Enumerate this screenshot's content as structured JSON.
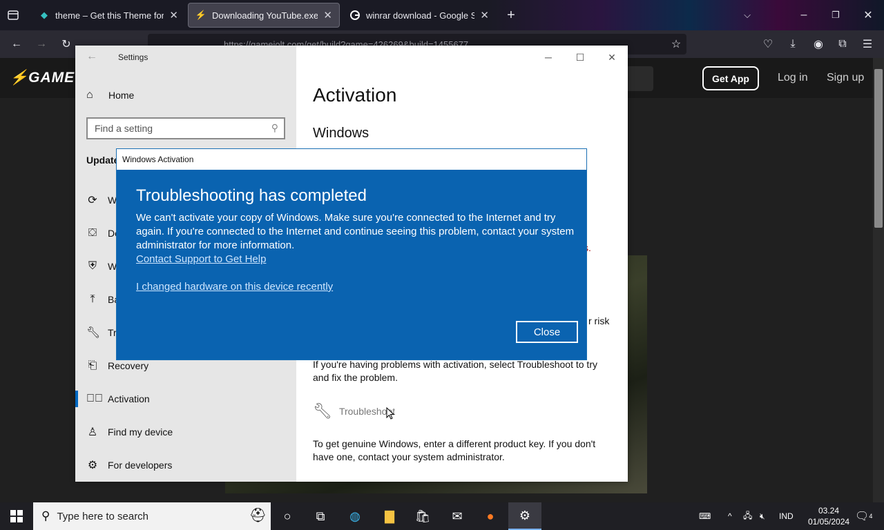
{
  "browser": {
    "tabs": [
      {
        "title": "theme – Get this Theme for",
        "favicon": "fox-icon"
      },
      {
        "title": "Downloading YouTube.exe (Ga",
        "favicon": "gamejolt-icon"
      },
      {
        "title": "winrar download - Google Sear",
        "favicon": "google-icon"
      }
    ],
    "url": "https://gamejolt.com/get/build?game=426269&build=1455677"
  },
  "site": {
    "logo": "GAME",
    "get_app": "Get App",
    "login": "Log in",
    "signup": "Sign up"
  },
  "settings": {
    "window_title": "Settings",
    "home": "Home",
    "search_placeholder": "Find a setting",
    "section": "Update",
    "nav": [
      {
        "label": "W",
        "icon": "sync-icon"
      },
      {
        "label": "De",
        "icon": "delivery-optimization-icon"
      },
      {
        "label": "W",
        "icon": "shield-icon"
      },
      {
        "label": "Ba",
        "icon": "backup-icon"
      },
      {
        "label": "Tr",
        "icon": "wrench-icon"
      },
      {
        "label": "Recovery",
        "icon": "recovery-icon"
      },
      {
        "label": "Activation",
        "icon": "check-circle-icon"
      },
      {
        "label": "Find my device",
        "icon": "person-pin-icon"
      },
      {
        "label": "For developers",
        "icon": "developer-icon"
      }
    ],
    "page_title": "Activation",
    "subheading": "Windows",
    "fragment_s": "s.",
    "fragment_risk": "r risk",
    "trouble_text": "If you're having problems with activation, select Troubleshoot to try and fix the problem.",
    "troubleshoot": "Troubleshoot",
    "product_key_text": "To get genuine Windows, enter a different product key. If you don't have one, contact your system administrator."
  },
  "dialog": {
    "title": "Windows Activation",
    "heading": "Troubleshooting has completed",
    "message": "We can't activate your copy of Windows. Make sure you're connected to the Internet and try again. If you're connected to the Internet and continue seeing this problem, contact your system administrator for more information.",
    "link_support": "Contact Support to Get Help",
    "link_hardware": "I changed hardware on this device recently",
    "close": "Close"
  },
  "taskbar": {
    "search_placeholder": "Type here to search",
    "lang": "IND",
    "time": "03.24",
    "date": "01/05/2024",
    "notifications": "4"
  },
  "colors": {
    "dialog_blue": "#0a63b0",
    "accent": "#0067c0"
  }
}
